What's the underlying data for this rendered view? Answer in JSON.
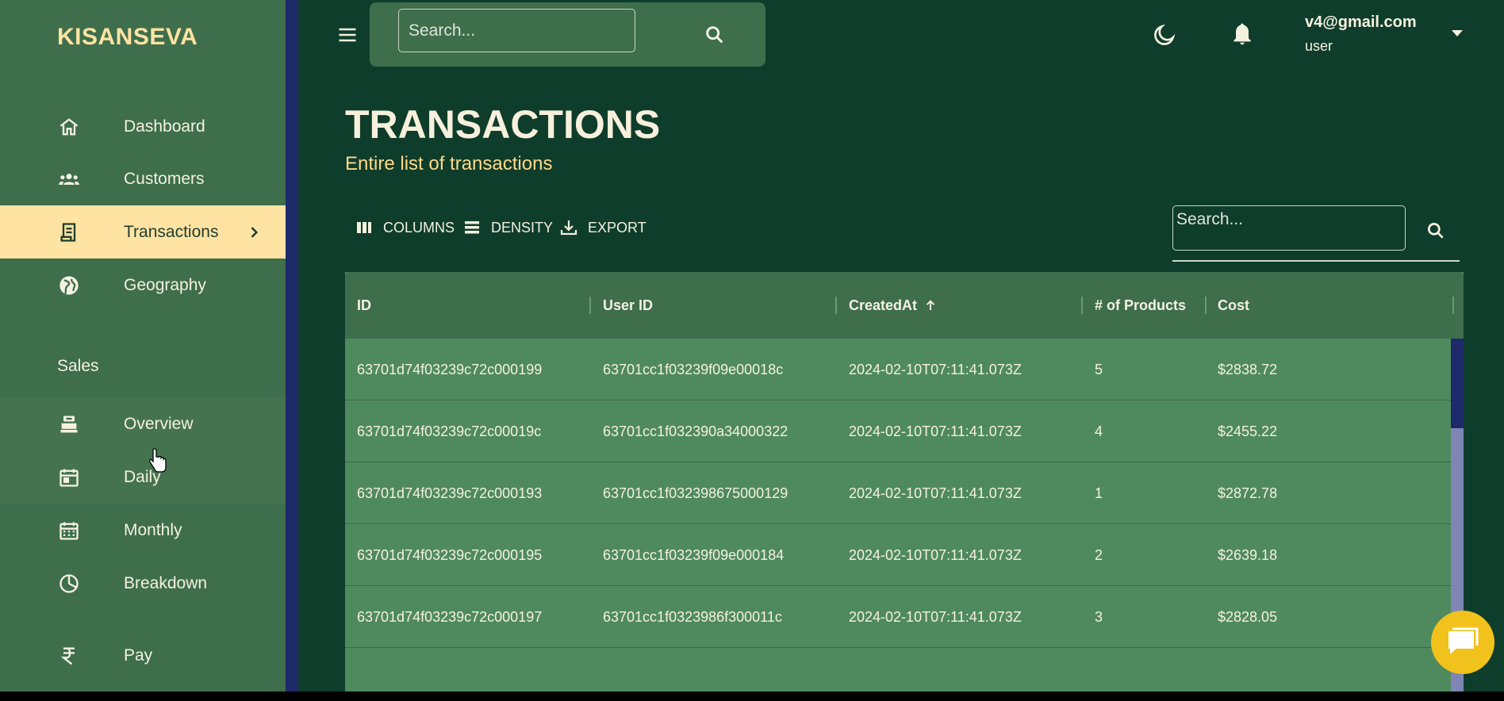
{
  "brand": "KISANSEVA",
  "sidebar": {
    "items": [
      {
        "label": "Dashboard",
        "icon": "home-icon"
      },
      {
        "label": "Customers",
        "icon": "groups-icon"
      },
      {
        "label": "Transactions",
        "icon": "receipt-icon",
        "active": true
      },
      {
        "label": "Geography",
        "icon": "globe-icon"
      }
    ],
    "section_label": "Sales",
    "sales_items": [
      {
        "label": "Overview",
        "icon": "point-of-sale-icon"
      },
      {
        "label": "Daily",
        "icon": "calendar-today-icon"
      },
      {
        "label": "Monthly",
        "icon": "calendar-month-icon"
      },
      {
        "label": "Breakdown",
        "icon": "pie-chart-icon"
      }
    ],
    "pay_item": {
      "label": "Pay",
      "icon": "rupee-icon"
    }
  },
  "topbar": {
    "search_placeholder": "Search...",
    "user_email": "v4@gmail.com",
    "user_role": "user"
  },
  "header": {
    "title": "TRANSACTIONS",
    "subtitle": "Entire list of transactions"
  },
  "toolbar": {
    "columns_label": "COLUMNS",
    "density_label": "DENSITY",
    "export_label": "EXPORT",
    "search_placeholder": "Search..."
  },
  "table": {
    "headers": {
      "id": "ID",
      "user_id": "User ID",
      "created_at": "CreatedAt",
      "products": "# of Products",
      "cost": "Cost"
    },
    "rows": [
      {
        "id": "63701d74f03239c72c000199",
        "user_id": "63701cc1f03239f09e00018c",
        "created_at": "2024-02-10T07:11:41.073Z",
        "products": "5",
        "cost": "$2838.72"
      },
      {
        "id": "63701d74f03239c72c00019c",
        "user_id": "63701cc1f032390a34000322",
        "created_at": "2024-02-10T07:11:41.073Z",
        "products": "4",
        "cost": "$2455.22"
      },
      {
        "id": "63701d74f03239c72c000193",
        "user_id": "63701cc1f032398675000129",
        "created_at": "2024-02-10T07:11:41.073Z",
        "products": "1",
        "cost": "$2872.78"
      },
      {
        "id": "63701d74f03239c72c000195",
        "user_id": "63701cc1f03239f09e000184",
        "created_at": "2024-02-10T07:11:41.073Z",
        "products": "2",
        "cost": "$2639.18"
      },
      {
        "id": "63701d74f03239c72c000197",
        "user_id": "63701cc1f0323986f300011c",
        "created_at": "2024-02-10T07:11:41.073Z",
        "products": "3",
        "cost": "$2828.05"
      }
    ]
  },
  "colors": {
    "sidebar_bg": "#3e6e4c",
    "main_bg": "#0f3d2b",
    "accent": "#ffe3a3",
    "row_bg": "#4f8a5e",
    "chat_button": "#f2c21c"
  }
}
